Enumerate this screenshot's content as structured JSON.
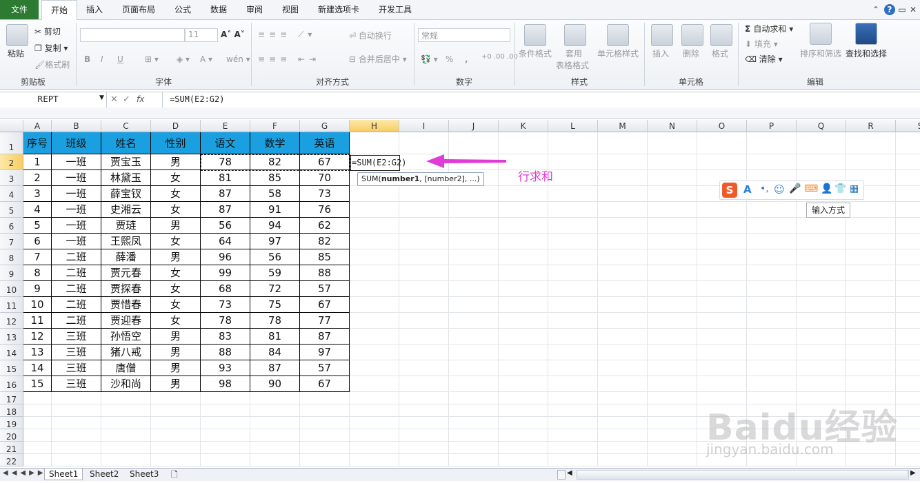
{
  "ribbon": {
    "tabs": [
      "文件",
      "开始",
      "插入",
      "页面布局",
      "公式",
      "数据",
      "审阅",
      "视图",
      "新建选项卡",
      "开发工具"
    ],
    "active_tab": "开始",
    "clipboard": {
      "paste": "粘贴",
      "cut": "剪切",
      "copy": "复制",
      "format_painter": "格式刷",
      "label": "剪贴板"
    },
    "font": {
      "size": "11",
      "bold": "B",
      "italic": "I",
      "underline": "U",
      "label": "字体"
    },
    "alignment": {
      "wrap": "自动换行",
      "merge": "合并后居中",
      "label": "对齐方式"
    },
    "number": {
      "format": "常规",
      "percent": "%",
      "comma": ",",
      "label": "数字"
    },
    "styles": {
      "conditional": "条件格式",
      "table_a": "套用",
      "table_b": "表格格式",
      "cell_styles": "单元格样式",
      "label": "样式"
    },
    "cells": {
      "insert": "插入",
      "delete": "删除",
      "format": "格式",
      "label": "单元格"
    },
    "editing": {
      "autosum": "自动求和",
      "fill": "填充",
      "clear": "清除",
      "sort": "排序和筛选",
      "find": "查找和选择",
      "label": "编辑"
    }
  },
  "formula_bar": {
    "name_box": "REPT",
    "formula": "=SUM(E2:G2)",
    "fx": "fx"
  },
  "columns": [
    "A",
    "B",
    "C",
    "D",
    "E",
    "F",
    "G",
    "H",
    "I",
    "J",
    "K",
    "L",
    "M",
    "N",
    "O",
    "P",
    "Q",
    "R",
    "S"
  ],
  "selected_column": "H",
  "row_numbers": [
    "1",
    "2",
    "3",
    "4",
    "5",
    "6",
    "7",
    "8",
    "9",
    "10",
    "11",
    "12",
    "13",
    "14",
    "15",
    "16",
    "17",
    "18",
    "19",
    "20",
    "21",
    "22"
  ],
  "selected_row": "2",
  "table": {
    "headers": [
      "序号",
      "班级",
      "姓名",
      "性别",
      "语文",
      "数学",
      "英语"
    ],
    "rows": [
      [
        "1",
        "一班",
        "贾宝玉",
        "男",
        "78",
        "82",
        "67"
      ],
      [
        "2",
        "一班",
        "林黛玉",
        "女",
        "81",
        "85",
        "70"
      ],
      [
        "3",
        "一班",
        "薛宝钗",
        "女",
        "87",
        "58",
        "73"
      ],
      [
        "4",
        "一班",
        "史湘云",
        "女",
        "87",
        "91",
        "76"
      ],
      [
        "5",
        "一班",
        "贾琏",
        "男",
        "56",
        "94",
        "62"
      ],
      [
        "6",
        "一班",
        "王熙凤",
        "女",
        "64",
        "97",
        "82"
      ],
      [
        "7",
        "二班",
        "薛潘",
        "男",
        "96",
        "56",
        "85"
      ],
      [
        "8",
        "二班",
        "贾元春",
        "女",
        "99",
        "59",
        "88"
      ],
      [
        "9",
        "二班",
        "贾探春",
        "女",
        "68",
        "72",
        "57"
      ],
      [
        "10",
        "二班",
        "贾惜春",
        "女",
        "73",
        "75",
        "67"
      ],
      [
        "11",
        "二班",
        "贾迎春",
        "女",
        "78",
        "78",
        "77"
      ],
      [
        "12",
        "三班",
        "孙悟空",
        "男",
        "83",
        "81",
        "87"
      ],
      [
        "13",
        "三班",
        "猪八戒",
        "男",
        "88",
        "84",
        "97"
      ],
      [
        "14",
        "三班",
        "唐僧",
        "男",
        "93",
        "87",
        "57"
      ],
      [
        "15",
        "三班",
        "沙和尚",
        "男",
        "98",
        "90",
        "67"
      ]
    ]
  },
  "editing_cell": {
    "text": "=SUM(E2:G2)"
  },
  "tooltip": {
    "fn": "SUM(",
    "arg1": "number1",
    ",rest": ", [number2], ...)",
    "rest": ", [number2], ...)"
  },
  "annotation": {
    "text": "行求和",
    "color": "#e23ad6"
  },
  "ime": {
    "tooltip": "输入方式"
  },
  "sheets": [
    "Sheet1",
    "Sheet2",
    "Sheet3"
  ],
  "watermark": {
    "brand": "Baidu经验",
    "url": "jingyan.baidu.com"
  }
}
